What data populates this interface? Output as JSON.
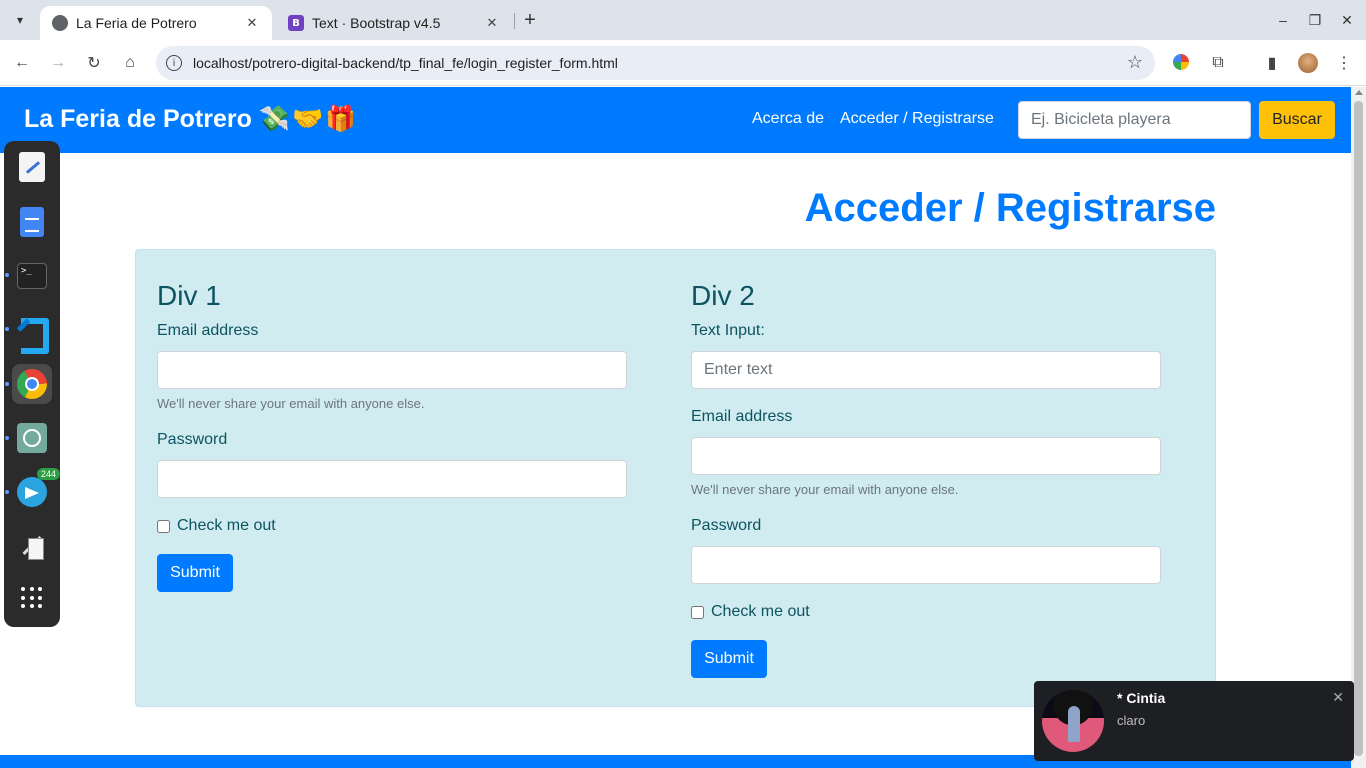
{
  "browser": {
    "tabs": [
      {
        "title": "La Feria de Potrero",
        "active": true
      },
      {
        "title": "Text · Bootstrap v4.5",
        "active": false
      }
    ],
    "url": "localhost/potrero-digital-backend/tp_final_fe/login_register_form.html",
    "tab_close_glyph": "✕",
    "new_tab_glyph": "+"
  },
  "navbar": {
    "brand": "La Feria de Potrero",
    "brand_emoji": "💸🤝🎁",
    "links": [
      "Acerca de",
      "Acceder / Registrarse"
    ],
    "search_placeholder": "Ej. Bicicleta playera",
    "search_button": "Buscar"
  },
  "page": {
    "title": "Acceder / Registrarse"
  },
  "div1": {
    "heading": "Div 1",
    "email_label": "Email address",
    "email_help": "We'll never share your email with anyone else.",
    "password_label": "Password",
    "check_label": "Check me out",
    "submit": "Submit"
  },
  "div2": {
    "heading": "Div 2",
    "text_label": "Text Input:",
    "text_placeholder": "Enter text",
    "email_label": "Email address",
    "email_help": "We'll never share your email with anyone else.",
    "password_label": "Password",
    "check_label": "Check me out",
    "submit": "Submit"
  },
  "dock": {
    "items": [
      "text-editor",
      "google-docs",
      "terminal",
      "vscode",
      "chrome",
      "chatgpt",
      "telegram",
      "drawing",
      "app-grid"
    ],
    "telegram_badge": "244"
  },
  "notification": {
    "sender": "* Cintia",
    "message": "claro"
  },
  "colors": {
    "primary": "#007bff",
    "warning": "#ffc107",
    "info_bg": "#d1ecf1",
    "info_text": "#0c5460"
  }
}
